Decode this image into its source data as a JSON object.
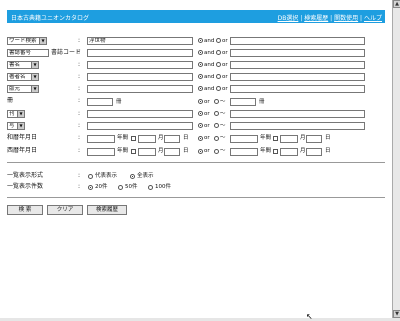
{
  "header": {
    "title": "日本古典籍ユニオンカタログ",
    "links": [
      "DB選択",
      "検索履歴",
      "関数使用",
      "ヘルプ"
    ],
    "separator": "|"
  },
  "fields": [
    {
      "selector": "ワード検索",
      "value": "浮世物",
      "op": "and",
      "alt": "or"
    },
    {
      "selector": "書誌番号",
      "sub": "書誌コード",
      "value": "",
      "op": "and",
      "alt": "or"
    },
    {
      "selector": "書名",
      "value": "",
      "op": "and",
      "alt": "or"
    },
    {
      "selector": "著者名",
      "value": "",
      "op": "and",
      "alt": "or"
    },
    {
      "selector": "版元",
      "value": "",
      "op": "and",
      "alt": "or"
    }
  ],
  "ryo": {
    "label": "冊",
    "unit": "冊",
    "op": "or",
    "alt": "～",
    "unit2": "冊"
  },
  "year1": {
    "selector": "刊",
    "op": "or",
    "alt": "～"
  },
  "year2": {
    "selector": "写",
    "op": "or",
    "alt": "～"
  },
  "wareki": {
    "label": "和暦年月日",
    "nen": "年間",
    "tsuki": "月",
    "hi": "日",
    "op": "or",
    "alt": "～"
  },
  "seireki": {
    "label": "西暦年月日",
    "nen": "年間",
    "tsuki": "月",
    "hi": "日",
    "op": "or",
    "alt": "～"
  },
  "display": {
    "label": "一覧表示形式",
    "options": [
      "代表表示",
      "全表示"
    ],
    "selected": 1
  },
  "count": {
    "label": "一覧表示件数",
    "options": [
      "20件",
      "50件",
      "100件"
    ],
    "selected": 0
  },
  "buttons": {
    "search": "検 索",
    "clear": "クリア",
    "history": "検索履歴"
  }
}
